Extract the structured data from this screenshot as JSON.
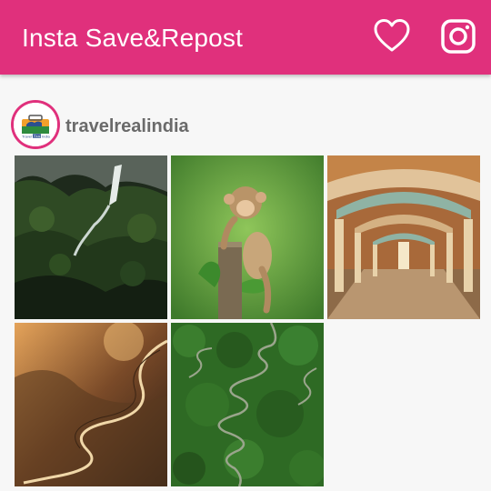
{
  "app": {
    "title": "Insta Save&Repost",
    "bar_color": "#e0307c",
    "actions": [
      {
        "name": "favorites",
        "icon": "heart-outline-icon"
      },
      {
        "name": "instagram",
        "icon": "instagram-icon"
      }
    ]
  },
  "profile": {
    "username": "travelrealindia",
    "avatar_icon": "travelrealindia-logo"
  },
  "posts": [
    {
      "subject": "waterfall in green valley"
    },
    {
      "subject": "baby monkey on tree stump"
    },
    {
      "subject": "ornate palace corridor"
    },
    {
      "subject": "winding mountain road at sunset"
    },
    {
      "subject": "aerial winding road through forest"
    }
  ]
}
